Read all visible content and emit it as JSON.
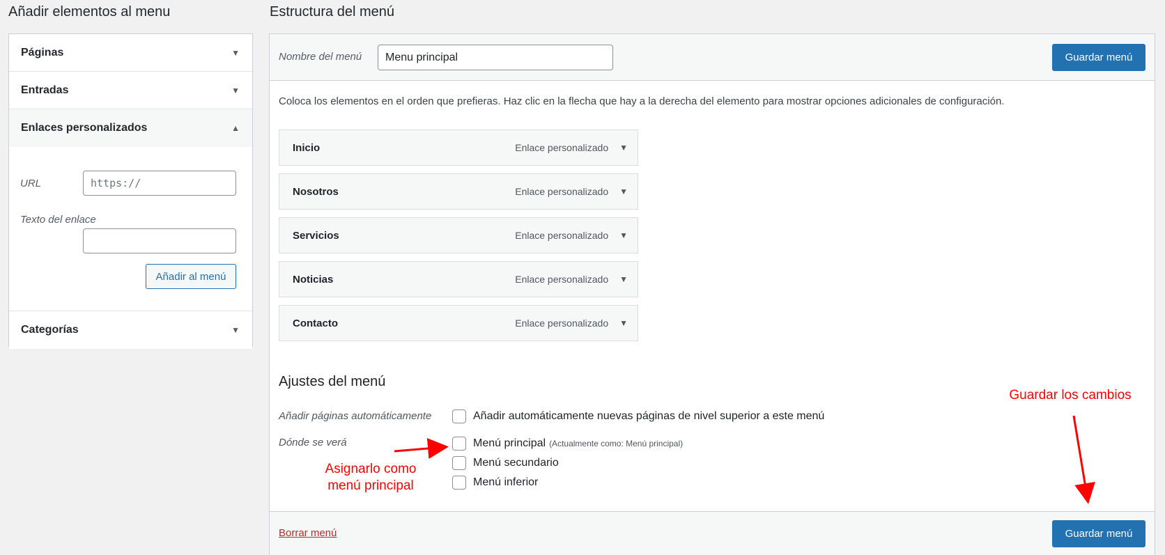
{
  "left": {
    "title": "Añadir elementos al menu",
    "sections": {
      "pages": "Páginas",
      "posts": "Entradas",
      "custom_links": "Enlaces personalizados",
      "categories": "Categorías"
    },
    "custom_links_form": {
      "url_label": "URL",
      "url_value": "https://",
      "link_text_label": "Texto del enlace",
      "link_text_value": "",
      "add_button": "Añadir al menú"
    }
  },
  "right": {
    "title": "Estructura del menú",
    "menu_name_label": "Nombre del menú",
    "menu_name_value": "Menu principal",
    "save_button": "Guardar menú",
    "instructions": "Coloca los elementos en el orden que prefieras. Haz clic en la flecha que hay a la derecha del elemento para mostrar opciones adicionales de configuración.",
    "menu_items": [
      {
        "title": "Inicio",
        "type": "Enlace personalizado"
      },
      {
        "title": "Nosotros",
        "type": "Enlace personalizado"
      },
      {
        "title": "Servicios",
        "type": "Enlace personalizado"
      },
      {
        "title": "Noticias",
        "type": "Enlace personalizado"
      },
      {
        "title": "Contacto",
        "type": "Enlace personalizado"
      }
    ],
    "settings": {
      "title": "Ajustes del menú",
      "auto_add_label": "Añadir páginas automáticamente",
      "auto_add_option": "Añadir automáticamente nuevas páginas de nivel superior a este menú",
      "location_label": "Dónde se verá",
      "locations": [
        {
          "label": "Menú principal",
          "note": "(Actualmente como: Menú principal)"
        },
        {
          "label": "Menú secundario",
          "note": ""
        },
        {
          "label": "Menú inferior",
          "note": ""
        }
      ]
    },
    "delete_link": "Borrar menú",
    "save_button_bottom": "Guardar menú"
  },
  "annotations": {
    "save_changes": "Guardar los cambios",
    "assign_line1": "Asignarlo como",
    "assign_line2": "menú principal",
    "color": "#ff0000"
  },
  "icons": {
    "collapsed": "▼",
    "expanded": "▲"
  },
  "colors": {
    "primary": "#2271b1",
    "delete": "#b32d2e",
    "annotation": "#ff0000"
  }
}
